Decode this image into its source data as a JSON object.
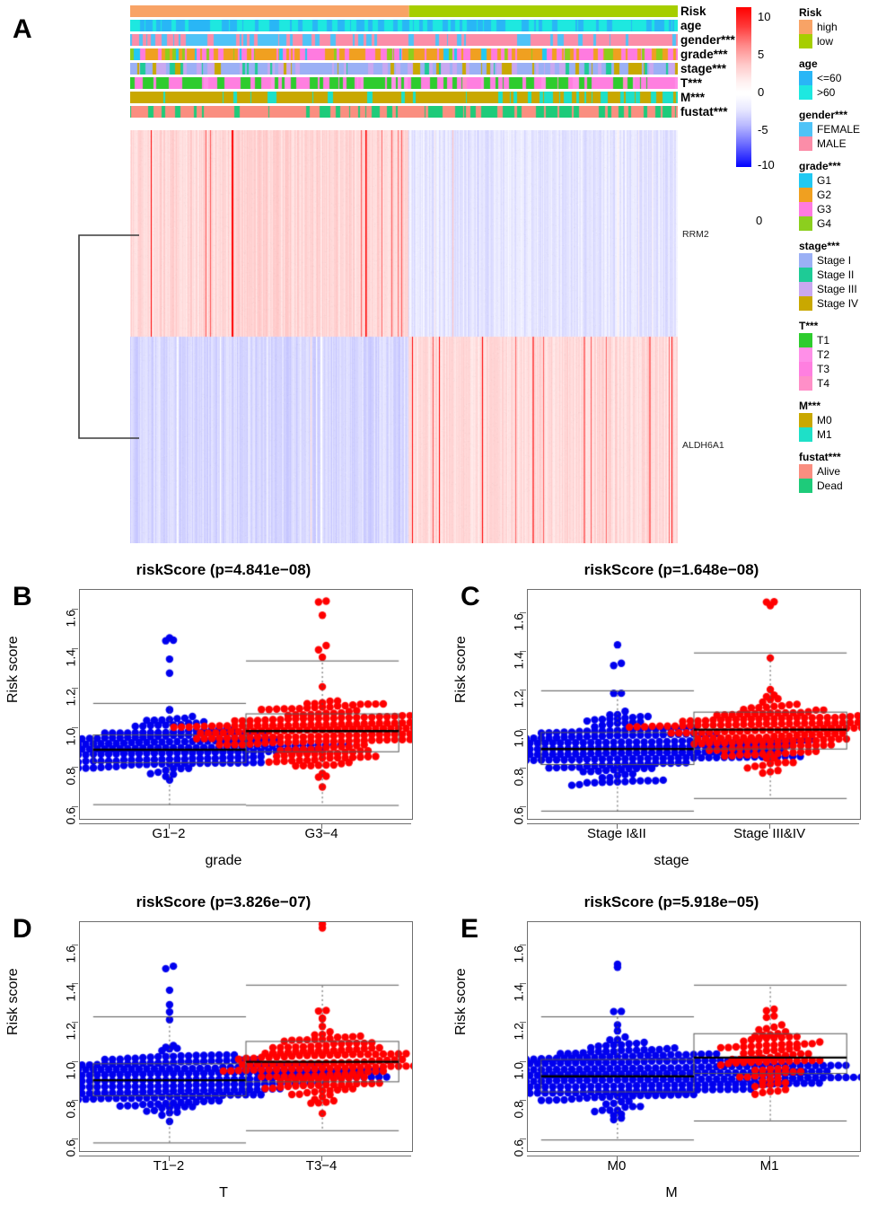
{
  "panels": {
    "a": {
      "letter": "A"
    },
    "b": {
      "letter": "B"
    },
    "c": {
      "letter": "C"
    },
    "d": {
      "letter": "D"
    },
    "e": {
      "letter": "E"
    }
  },
  "heatmap": {
    "annotation_rows": [
      {
        "key": "Risk",
        "label": "Risk",
        "type": "block",
        "categories": [
          "high",
          "low"
        ],
        "colors": [
          "#F8A366",
          "#A6CE00"
        ],
        "split_fraction": 0.51,
        "seed": 11
      },
      {
        "key": "age",
        "label": "age",
        "type": "random",
        "categories": [
          "<=60",
          ">60"
        ],
        "colors": [
          "#29B6F6",
          "#1EE8E0"
        ],
        "weights": [
          0.45,
          0.55
        ],
        "seed": 22
      },
      {
        "key": "gender",
        "label": "gender***",
        "type": "random",
        "categories": [
          "FEMALE",
          "MALE"
        ],
        "colors": [
          "#4FC3F7",
          "#FB8DA8"
        ],
        "weights": [
          0.36,
          0.64
        ],
        "seed": 33
      },
      {
        "key": "grade",
        "label": "grade***",
        "type": "random",
        "categories": [
          "G1",
          "G2",
          "G3",
          "G4"
        ],
        "colors": [
          "#22C9F2",
          "#F0A020",
          "#FF7BE0",
          "#8CCF1E"
        ],
        "weights": [
          0.07,
          0.44,
          0.36,
          0.13
        ],
        "seed": 44
      },
      {
        "key": "stage",
        "label": "stage***",
        "type": "random",
        "categories": [
          "Stage I",
          "Stage II",
          "Stage III",
          "Stage IV"
        ],
        "colors": [
          "#9BB0F5",
          "#1ECB96",
          "#C9A8F0",
          "#C9A800"
        ],
        "weights": [
          0.49,
          0.1,
          0.24,
          0.17
        ],
        "seed": 55
      },
      {
        "key": "T",
        "label": "T***",
        "type": "random",
        "categories": [
          "T1",
          "T2",
          "T3",
          "T4"
        ],
        "colors": [
          "#2ECC2E",
          "#FF8FE8",
          "#FF7FE0",
          "#FF8FC8"
        ],
        "weights": [
          0.5,
          0.13,
          0.34,
          0.03
        ],
        "seed": 66
      },
      {
        "key": "M",
        "label": "M***",
        "type": "random",
        "categories": [
          "M0",
          "M1"
        ],
        "colors": [
          "#C9A800",
          "#1EE0C8"
        ],
        "weights": [
          0.8,
          0.2
        ],
        "seed": 77
      },
      {
        "key": "fustat",
        "label": "fustat***",
        "type": "random",
        "categories": [
          "Alive",
          "Dead"
        ],
        "colors": [
          "#FA8E80",
          "#1ECB7A"
        ],
        "weights": [
          0.67,
          0.33
        ],
        "seed": 88
      }
    ],
    "genes": [
      "RRM2",
      "ALDH6A1"
    ],
    "n_samples": 530,
    "colorbar": {
      "ticks": [
        "10",
        "5",
        "0",
        "-5",
        "-10"
      ],
      "values": [
        10,
        5,
        0,
        -5,
        -10
      ],
      "min": -10,
      "max": 10,
      "low_color": "#0000FF",
      "mid_color": "#FFFFFF",
      "high_color": "#FF0000"
    },
    "stray_label": "0"
  },
  "legends": [
    {
      "title": "Risk",
      "items": [
        {
          "label": "high",
          "color": "#F8A366"
        },
        {
          "label": "low",
          "color": "#A6CE00"
        }
      ]
    },
    {
      "title": "age",
      "items": [
        {
          "label": "<=60",
          "color": "#29B6F6"
        },
        {
          "label": ">60",
          "color": "#1EE8E0"
        }
      ]
    },
    {
      "title": "gender***",
      "items": [
        {
          "label": "FEMALE",
          "color": "#4FC3F7"
        },
        {
          "label": "MALE",
          "color": "#FB8DA8"
        }
      ]
    },
    {
      "title": "grade***",
      "items": [
        {
          "label": "G1",
          "color": "#22C9F2"
        },
        {
          "label": "G2",
          "color": "#F0A020"
        },
        {
          "label": "G3",
          "color": "#FF7BE0"
        },
        {
          "label": "G4",
          "color": "#8CCF1E"
        }
      ]
    },
    {
      "title": "stage***",
      "items": [
        {
          "label": "Stage I",
          "color": "#9BB0F5"
        },
        {
          "label": "Stage II",
          "color": "#1ECB96"
        },
        {
          "label": "Stage III",
          "color": "#C9A8F0"
        },
        {
          "label": "Stage IV",
          "color": "#C9A800"
        }
      ]
    },
    {
      "title": "T***",
      "items": [
        {
          "label": "T1",
          "color": "#2ECC2E"
        },
        {
          "label": "T2",
          "color": "#FF8FE8"
        },
        {
          "label": "T3",
          "color": "#FF7FE0"
        },
        {
          "label": "T4",
          "color": "#FF8FC8"
        }
      ]
    },
    {
      "title": "M***",
      "items": [
        {
          "label": "M0",
          "color": "#C9A800"
        },
        {
          "label": "M1",
          "color": "#1EE0C8"
        }
      ]
    },
    {
      "title": "fustat***",
      "items": [
        {
          "label": "Alive",
          "color": "#FA8E80"
        },
        {
          "label": "Dead",
          "color": "#1ECB7A"
        }
      ]
    }
  ],
  "chart_data": [
    {
      "panel": "B",
      "type": "scatter",
      "title": "riskScore (p=4.841e−08)",
      "xlabel": "grade",
      "ylabel": "Risk score",
      "ylim": [
        0.54,
        1.7
      ],
      "yticks": [
        0.6,
        0.8,
        1.0,
        1.2,
        1.4,
        1.6
      ],
      "ytick_labels": [
        "0.6",
        "0.8",
        "1.0",
        "1.2",
        "1.4",
        "1.6"
      ],
      "p_value": "4.841e-08",
      "categories": [
        "G1−2",
        "G3−4"
      ],
      "series": [
        {
          "name": "G1−2",
          "color": "#0000EE",
          "n": 245,
          "center": 0.905,
          "spread": 0.115,
          "box": {
            "q1": 0.825,
            "median": 0.89,
            "q3": 0.965,
            "lower_whisker": 0.612,
            "upper_whisker": 1.125
          }
        },
        {
          "name": "G3−4",
          "color": "#FF0000",
          "n": 250,
          "center": 0.975,
          "spread": 0.135,
          "box": {
            "q1": 0.88,
            "median": 0.985,
            "q3": 1.072,
            "lower_whisker": 0.608,
            "upper_whisker": 1.34
          }
        }
      ]
    },
    {
      "panel": "C",
      "type": "scatter",
      "title": "riskScore (p=1.648e−08)",
      "xlabel": "stage",
      "ylabel": "Risk score",
      "ylim": [
        0.54,
        1.72
      ],
      "yticks": [
        0.6,
        0.8,
        1.0,
        1.2,
        1.4,
        1.6
      ],
      "ytick_labels": [
        "0.6",
        "0.8",
        "1.0",
        "1.2",
        "1.4",
        "1.6"
      ],
      "p_value": "1.648e-08",
      "categories": [
        "Stage I&II",
        "Stage III&IV"
      ],
      "series": [
        {
          "name": "Stage I&II",
          "color": "#0000EE",
          "n": 310,
          "center": 0.905,
          "spread": 0.115,
          "box": {
            "q1": 0.82,
            "median": 0.9,
            "q3": 0.985,
            "lower_whisker": 0.58,
            "upper_whisker": 1.2
          }
        },
        {
          "name": "Stage III&IV",
          "color": "#FF0000",
          "n": 205,
          "center": 0.99,
          "spread": 0.145,
          "box": {
            "q1": 0.9,
            "median": 1.0,
            "q3": 1.09,
            "lower_whisker": 0.645,
            "upper_whisker": 1.395
          }
        }
      ]
    },
    {
      "panel": "D",
      "type": "scatter",
      "title": "riskScore (p=3.826e−07)",
      "xlabel": "T",
      "ylabel": "Risk score",
      "ylim": [
        0.54,
        1.72
      ],
      "yticks": [
        0.6,
        0.8,
        1.0,
        1.2,
        1.4,
        1.6
      ],
      "ytick_labels": [
        "0.6",
        "0.8",
        "1.0",
        "1.2",
        "1.4",
        "1.6"
      ],
      "p_value": "3.826e-07",
      "categories": [
        "T1−2",
        "T3−4"
      ],
      "series": [
        {
          "name": "T1−2",
          "color": "#0000EE",
          "n": 330,
          "center": 0.912,
          "spread": 0.118,
          "box": {
            "q1": 0.825,
            "median": 0.905,
            "q3": 0.99,
            "lower_whisker": 0.582,
            "upper_whisker": 1.232
          }
        },
        {
          "name": "T3−4",
          "color": "#FF0000",
          "n": 185,
          "center": 0.995,
          "spread": 0.145,
          "box": {
            "q1": 0.897,
            "median": 1.0,
            "q3": 1.105,
            "lower_whisker": 0.645,
            "upper_whisker": 1.395
          }
        }
      ]
    },
    {
      "panel": "E",
      "type": "scatter",
      "title": "riskScore (p=5.918e−05)",
      "xlabel": "M",
      "ylabel": "Risk score",
      "ylim": [
        0.54,
        1.72
      ],
      "yticks": [
        0.6,
        0.8,
        1.0,
        1.2,
        1.4,
        1.6
      ],
      "ytick_labels": [
        "0.6",
        "0.8",
        "1.0",
        "1.2",
        "1.4",
        "1.6"
      ],
      "p_value": "5.918e-05",
      "categories": [
        "M0",
        "M1"
      ],
      "series": [
        {
          "name": "M0",
          "color": "#0000EE",
          "n": 420,
          "center": 0.93,
          "spread": 0.125,
          "box": {
            "q1": 0.845,
            "median": 0.925,
            "q3": 1.012,
            "lower_whisker": 0.597,
            "upper_whisker": 1.232
          }
        },
        {
          "name": "M1",
          "color": "#FF0000",
          "n": 95,
          "center": 1.035,
          "spread": 0.15,
          "box": {
            "q1": 0.94,
            "median": 1.022,
            "q3": 1.145,
            "lower_whisker": 0.695,
            "upper_whisker": 1.395
          }
        }
      ]
    }
  ]
}
